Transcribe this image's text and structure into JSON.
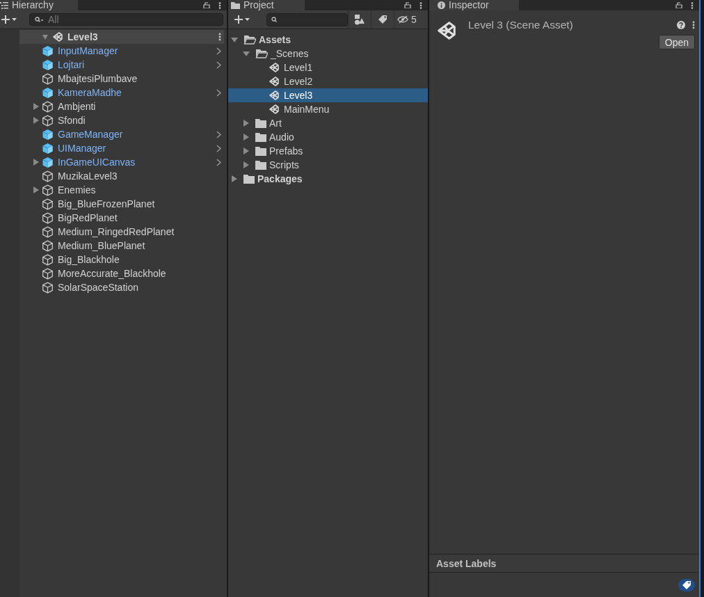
{
  "hierarchy": {
    "tab": "Hierarchy",
    "search": {
      "placeholder": "All"
    },
    "scene": {
      "name": "Level3",
      "expanded": true,
      "children": [
        {
          "name": "InputManager",
          "kind": "prefab",
          "expandable": false
        },
        {
          "name": "Lojtari",
          "kind": "prefab",
          "expandable": false
        },
        {
          "name": "MbajtesiPlumbave",
          "kind": "object",
          "expandable": false
        },
        {
          "name": "KameraMadhe",
          "kind": "prefab",
          "expandable": false
        },
        {
          "name": "Ambjenti",
          "kind": "object",
          "expandable": true
        },
        {
          "name": "Sfondi",
          "kind": "object",
          "expandable": true
        },
        {
          "name": "GameManager",
          "kind": "prefab",
          "expandable": false
        },
        {
          "name": "UIManager",
          "kind": "prefab",
          "expandable": false
        },
        {
          "name": "InGameUICanvas",
          "kind": "prefab",
          "expandable": true
        },
        {
          "name": "MuzikaLevel3",
          "kind": "object",
          "expandable": false
        },
        {
          "name": "Enemies",
          "kind": "object",
          "expandable": true
        },
        {
          "name": "Big_BlueFrozenPlanet",
          "kind": "object",
          "expandable": false
        },
        {
          "name": "BigRedPlanet",
          "kind": "object",
          "expandable": false
        },
        {
          "name": "Medium_RingedRedPlanet",
          "kind": "object",
          "expandable": false
        },
        {
          "name": "Medium_BluePlanet",
          "kind": "object",
          "expandable": false
        },
        {
          "name": "Big_Blackhole",
          "kind": "object",
          "expandable": false
        },
        {
          "name": "MoreAccurate_Blackhole",
          "kind": "object",
          "expandable": false
        },
        {
          "name": "SolarSpaceStation",
          "kind": "object",
          "expandable": false
        }
      ]
    }
  },
  "project": {
    "tab": "Project",
    "hidden_count": "5",
    "tree": [
      {
        "name": "Assets",
        "kind": "folder",
        "expanded": true,
        "selected": false,
        "children": [
          {
            "name": "_Scenes",
            "kind": "folder",
            "expanded": true,
            "selected": false,
            "children": [
              {
                "name": "Level1",
                "kind": "scene",
                "selected": false
              },
              {
                "name": "Level2",
                "kind": "scene",
                "selected": false
              },
              {
                "name": "Level3",
                "kind": "scene",
                "selected": true
              },
              {
                "name": "MainMenu",
                "kind": "scene",
                "selected": false
              }
            ]
          },
          {
            "name": "Art",
            "kind": "folder",
            "expanded": false,
            "selected": false
          },
          {
            "name": "Audio",
            "kind": "folder",
            "expanded": false,
            "selected": false
          },
          {
            "name": "Prefabs",
            "kind": "folder",
            "expanded": false,
            "selected": false
          },
          {
            "name": "Scripts",
            "kind": "folder",
            "expanded": false,
            "selected": false
          }
        ]
      },
      {
        "name": "Packages",
        "kind": "folder",
        "expanded": false,
        "selected": false
      }
    ]
  },
  "inspector": {
    "tab": "Inspector",
    "title": "Level 3 (Scene Asset)",
    "open_button": "Open",
    "labels_heading": "Asset Labels"
  }
}
